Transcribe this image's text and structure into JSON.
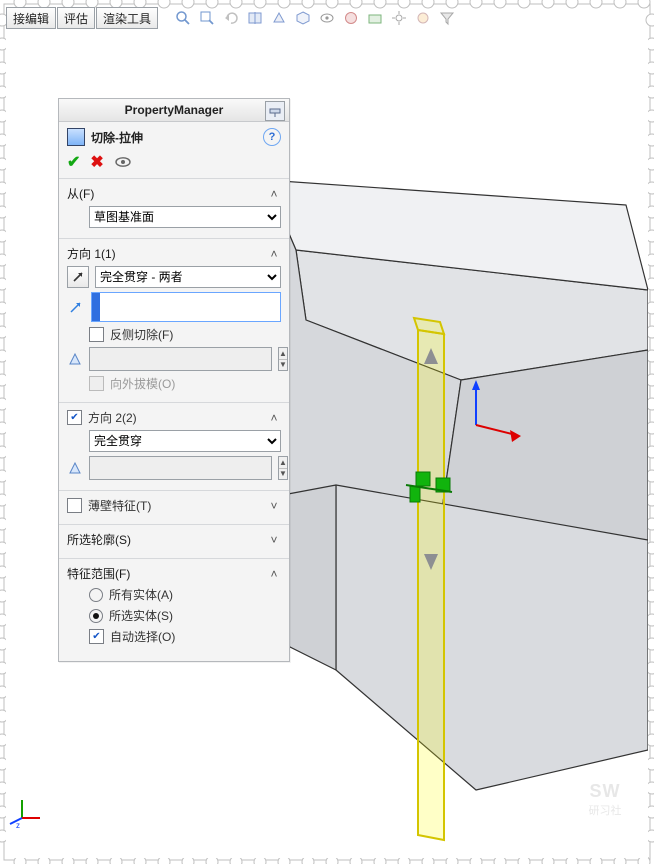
{
  "tabs": {
    "t1": "接编辑",
    "t2": "评估",
    "t3": "渲染工具"
  },
  "pm": {
    "title": "PropertyManager",
    "feature": "切除-拉伸",
    "from": {
      "header": "从(F)",
      "option": "草图基准面"
    },
    "dir1": {
      "header": "方向 1(1)",
      "end": "完全贯穿 - 两者",
      "flip": "反侧切除(F)",
      "draftOut": "向外拔模(O)"
    },
    "dir2": {
      "header": "方向 2(2)",
      "end": "完全贯穿"
    },
    "thin": {
      "header": "薄壁特征(T)"
    },
    "contours": {
      "header": "所选轮廓(S)"
    },
    "scope": {
      "header": "特征范围(F)",
      "all": "所有实体(A)",
      "selected": "所选实体(S)",
      "auto": "自动选择(O)"
    }
  },
  "watermark": {
    "line1": "SW",
    "line2": "研习社"
  }
}
